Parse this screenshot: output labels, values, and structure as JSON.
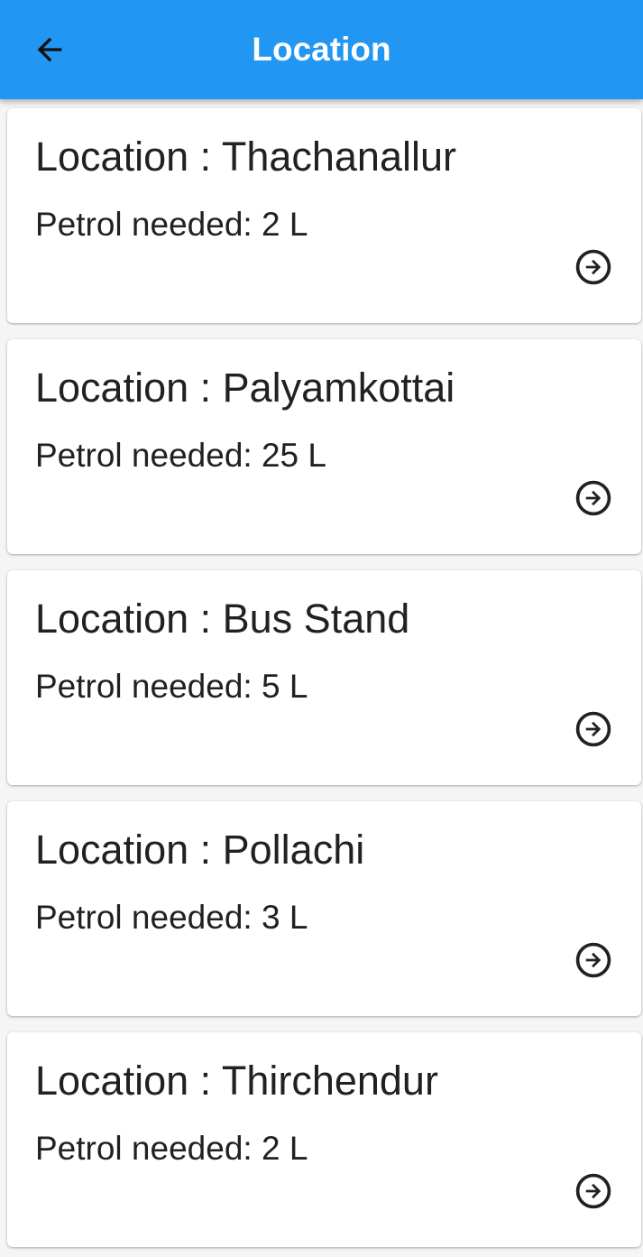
{
  "appbar": {
    "title": "Location",
    "back_icon": "arrow-back-icon"
  },
  "locations": [
    {
      "title": "Location : Thachanallur",
      "petrol": "Petrol needed: 2 L",
      "action_icon": "arrow-circle-right-icon"
    },
    {
      "title": "Location : Palyamkottai",
      "petrol": "Petrol needed: 25 L",
      "action_icon": "arrow-circle-right-icon"
    },
    {
      "title": "Location : Bus Stand",
      "petrol": "Petrol needed: 5 L",
      "action_icon": "arrow-circle-right-icon"
    },
    {
      "title": "Location : Pollachi",
      "petrol": "Petrol needed: 3 L",
      "action_icon": "arrow-circle-right-icon"
    },
    {
      "title": "Location : Thirchendur",
      "petrol": "Petrol needed: 2 L",
      "action_icon": "arrow-circle-right-icon"
    }
  ],
  "colors": {
    "appbar": "#2196f3",
    "background": "#f5f5f5",
    "card": "#ffffff",
    "text": "#212121"
  }
}
